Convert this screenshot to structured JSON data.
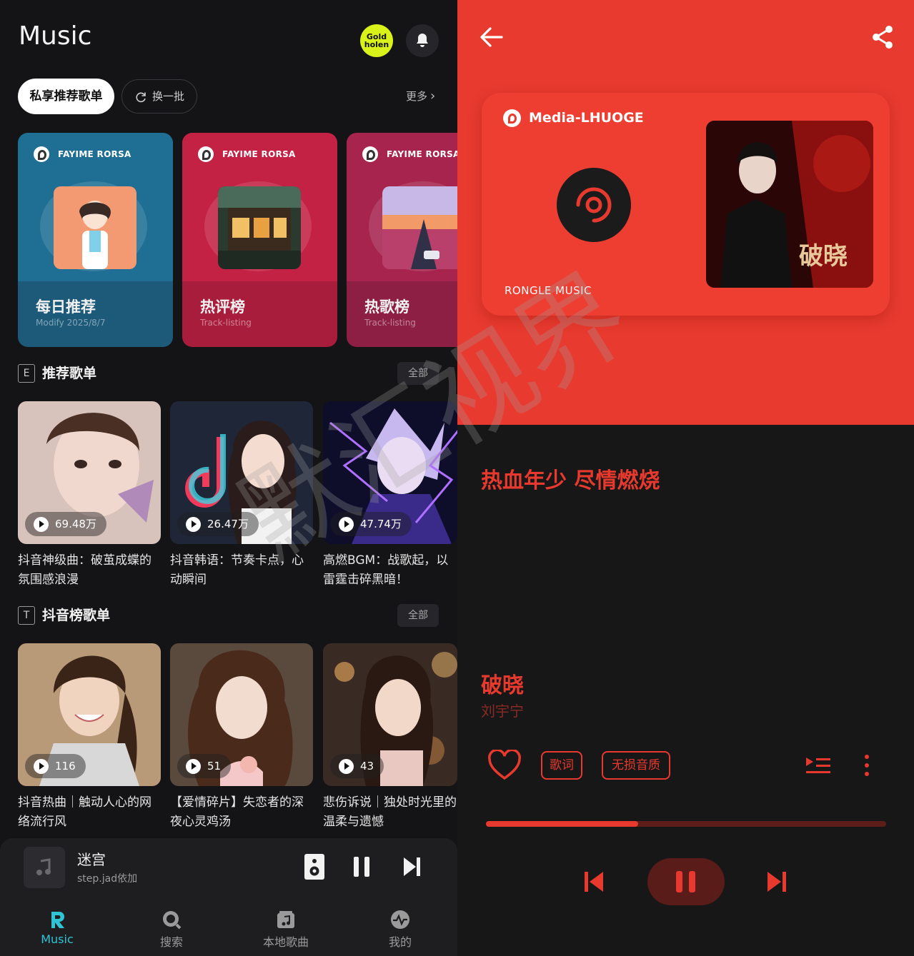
{
  "left": {
    "header": {
      "title": "Music",
      "badge_text": "Gold\nholen"
    },
    "filters": {
      "active": "私享推荐歌单",
      "refresh": "换一批",
      "more": "更多"
    },
    "featured": [
      {
        "brand": "FAYIME RORSA",
        "name": "每日推荐",
        "sub": "Modify  2025/8/7",
        "color_top": "#1f6f95",
        "color_bottom": "#1d5a7a"
      },
      {
        "brand": "FAYIME RORSA",
        "name": "热评榜",
        "sub": "Track-listing",
        "color_top": "#c42245",
        "color_bottom": "#a81c3c"
      },
      {
        "brand": "FAYIME RORSA",
        "name": "热歌榜",
        "sub": "Track-listing",
        "color_top": "#a7244f",
        "color_bottom": "#8d1f44"
      }
    ],
    "sections": [
      {
        "icon": "E",
        "title": "推荐歌单",
        "all": "全部",
        "items": [
          {
            "count": "69.48万",
            "title": "抖音神级曲：破茧成蝶的氛围感浪漫"
          },
          {
            "count": "26.47万",
            "title": "抖音韩语：节奏卡点，心动瞬间"
          },
          {
            "count": "47.74万",
            "title": "高燃BGM：战歌起，以雷霆击碎黑暗！"
          }
        ]
      },
      {
        "icon": "T",
        "title": "抖音榜歌单",
        "all": "全部",
        "items": [
          {
            "count": "116",
            "title": "抖音热曲｜触动人心的网络流行风"
          },
          {
            "count": "51",
            "title": "【爱情碎片】失恋者的深夜心灵鸡汤"
          },
          {
            "count": "43",
            "title": "悲伤诉说｜独处时光里的温柔与遗憾"
          }
        ]
      }
    ],
    "mini_player": {
      "title": "迷宫",
      "artist": "step.jad依加"
    },
    "nav": [
      {
        "label": "Music",
        "icon": "r-logo-icon",
        "active": true
      },
      {
        "label": "搜索",
        "icon": "search-icon",
        "active": false
      },
      {
        "label": "本地歌曲",
        "icon": "music-folder-icon",
        "active": false
      },
      {
        "label": "我的",
        "icon": "pulse-icon",
        "active": false
      }
    ],
    "accent": "#2ec4d6"
  },
  "right": {
    "media": {
      "brand": "Media-LHUOGE",
      "footer": "RONGLE  MUSIC",
      "art_text": "破晓"
    },
    "slogan": "热血年少 尽情燃烧",
    "song": {
      "title": "破晓",
      "artist": "刘宇宁"
    },
    "tags": [
      "歌词",
      "无损音质"
    ],
    "progress": 0.38,
    "accent": "#e8392e"
  },
  "watermark": "默汇视界"
}
